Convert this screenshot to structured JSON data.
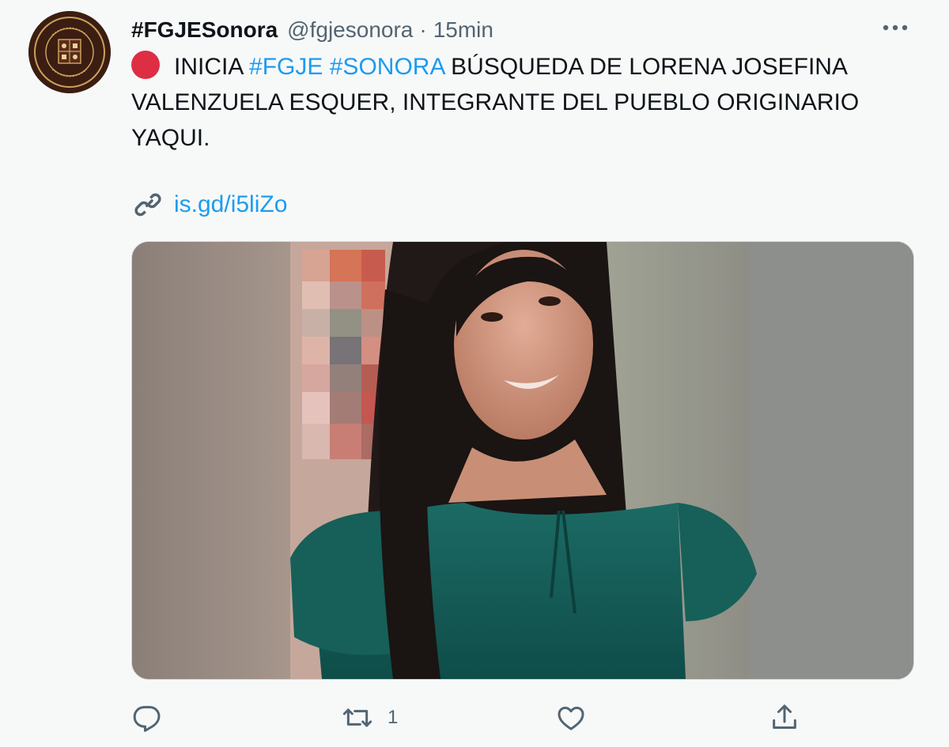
{
  "tweet": {
    "display_name": "#FGJESonora",
    "handle": "@fgjesonora",
    "separator": "·",
    "time": "15min",
    "text_lines": {
      "line1_prefix": "INICIA",
      "hashtag1": "#FGJE",
      "hashtag2": "#SONORA",
      "line1_suffix": "BÚSQUEDA DE LORENA JOSEFINA",
      "line2": "VALENZUELA ESQUER, INTEGRANTE DEL PUEBLO ORIGINARIO",
      "line3": "YAQUI."
    },
    "link_text": "is.gd/i5liZo",
    "actions": {
      "reply_count": "",
      "retweet_count": "1",
      "like_count": ""
    }
  },
  "icons": {
    "avatar": "agency-seal-logo",
    "status": "red-circle-emoji",
    "link": "link-icon",
    "more": "more-options-icon",
    "reply": "reply-icon",
    "retweet": "retweet-icon",
    "like": "heart-icon",
    "share": "share-icon"
  },
  "colors": {
    "background": "#f7f9f9",
    "hashtag": "#1d9bf0",
    "secondary_text": "#536471",
    "red_dot": "#dd2e44"
  }
}
